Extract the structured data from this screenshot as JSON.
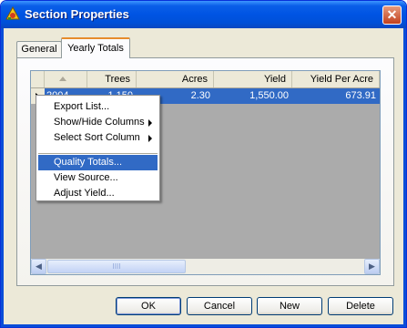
{
  "window": {
    "title": "Section Properties",
    "close_glyph": "✕",
    "icon": "app-icon"
  },
  "tabs": [
    {
      "label": "General",
      "selected": false
    },
    {
      "label": "Yearly Totals",
      "selected": true
    }
  ],
  "grid": {
    "columns": [
      "Trees",
      "Acres",
      "Yield",
      "Yield Per Acre"
    ],
    "rows": [
      {
        "year": "2004",
        "trees": "1,150",
        "acres": "2.30",
        "yield": "1,550.00",
        "yield_per_acre": "673.91"
      }
    ],
    "scroll_left": "◀",
    "scroll_right": "▶",
    "thumb_grip": "IIII"
  },
  "context_menu": {
    "items": [
      {
        "label": "Export List...",
        "submenu": false
      },
      {
        "label": "Show/Hide Columns",
        "submenu": true
      },
      {
        "label": "Select Sort Column",
        "submenu": true
      },
      {
        "label": "Quality Totals...",
        "submenu": false,
        "highlighted": true
      },
      {
        "label": "View Source...",
        "submenu": false
      },
      {
        "label": "Adjust Yield...",
        "submenu": false
      }
    ]
  },
  "buttons": {
    "ok": "OK",
    "cancel": "Cancel",
    "new": "New",
    "delete": "Delete"
  },
  "colors": {
    "selection": "#316ac5",
    "titlebar": "#0054e3",
    "dialog_bg": "#ece9d8"
  }
}
